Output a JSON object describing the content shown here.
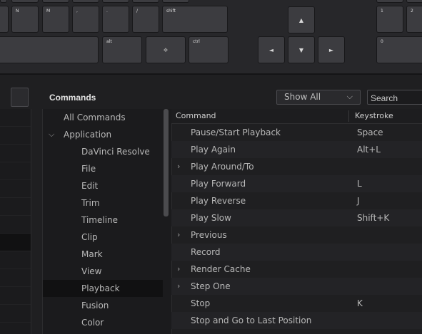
{
  "keyboard": {
    "keys_row1": [
      "",
      "N",
      "M",
      ",",
      ".",
      "/",
      "shift"
    ],
    "keys_row2": [
      "",
      "alt",
      "❖",
      "ctrl"
    ],
    "arrows": {
      "up": "▲",
      "left": "◄",
      "down": "▼",
      "right": "►"
    },
    "numpad": [
      "1",
      "2",
      "0"
    ]
  },
  "panel": {
    "title": "Commands",
    "filter_value": "Show All",
    "filter_chevron": "⌵",
    "search_placeholder": "Search"
  },
  "categories": [
    {
      "label": "All Commands",
      "indent": 0,
      "twisty": ""
    },
    {
      "label": "Application",
      "indent": 0,
      "twisty": "⌵"
    },
    {
      "label": "DaVinci Resolve",
      "indent": 1,
      "twisty": ""
    },
    {
      "label": "File",
      "indent": 1,
      "twisty": ""
    },
    {
      "label": "Edit",
      "indent": 1,
      "twisty": ""
    },
    {
      "label": "Trim",
      "indent": 1,
      "twisty": ""
    },
    {
      "label": "Timeline",
      "indent": 1,
      "twisty": ""
    },
    {
      "label": "Clip",
      "indent": 1,
      "twisty": ""
    },
    {
      "label": "Mark",
      "indent": 1,
      "twisty": ""
    },
    {
      "label": "View",
      "indent": 1,
      "twisty": ""
    },
    {
      "label": "Playback",
      "indent": 1,
      "twisty": "",
      "selected": true
    },
    {
      "label": "Fusion",
      "indent": 1,
      "twisty": ""
    },
    {
      "label": "Color",
      "indent": 1,
      "twisty": ""
    }
  ],
  "table": {
    "headers": {
      "command": "Command",
      "keystroke": "Keystroke"
    },
    "rows": [
      {
        "name": "Pause/Start Playback",
        "key": "Space",
        "expand": ""
      },
      {
        "name": "Play Again",
        "key": "Alt+L",
        "expand": ""
      },
      {
        "name": "Play Around/To",
        "key": "",
        "expand": "›"
      },
      {
        "name": "Play Forward",
        "key": "L",
        "expand": ""
      },
      {
        "name": "Play Reverse",
        "key": "J",
        "expand": ""
      },
      {
        "name": "Play Slow",
        "key": "Shift+K",
        "expand": ""
      },
      {
        "name": "Previous",
        "key": "",
        "expand": "›"
      },
      {
        "name": "Record",
        "key": "",
        "expand": ""
      },
      {
        "name": "Render Cache",
        "key": "",
        "expand": "›"
      },
      {
        "name": "Step One",
        "key": "",
        "expand": "›"
      },
      {
        "name": "Stop",
        "key": "K",
        "expand": ""
      },
      {
        "name": "Stop and Go to Last Position",
        "key": "",
        "expand": ""
      }
    ]
  }
}
